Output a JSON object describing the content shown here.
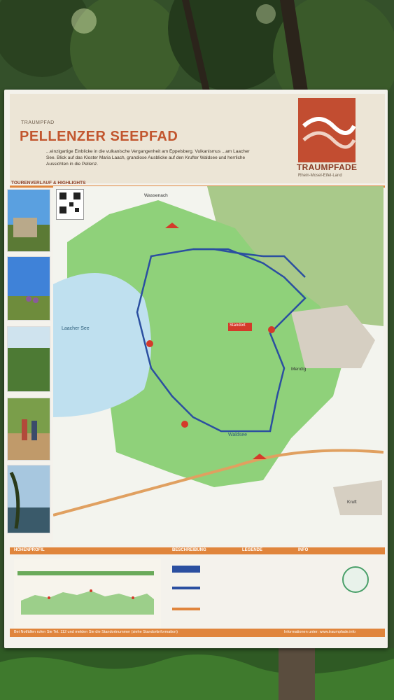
{
  "sign": {
    "kicker": "TRAUMPFAD",
    "title": "PELLENZER SEEPFAD",
    "intro": "...einzigartige Einblicke in die vulkanische Vergangenheit am Eppelsberg. Vulkanismus ...am Laacher See. Blick auf das Kloster Maria Laach, grandiose Ausblicke auf den Krufter Waldsee und herrliche Aussichten in die Pellenz.",
    "logo_name": "TRAUMPFADE",
    "logo_sub": "Rhein-Mosel-Eifel-Land",
    "section_route": "TOURENVERLAUF & HIGHLIGHTS",
    "section_profile": "HÖHENPROFIL",
    "section_description": "BESCHREIBUNG",
    "section_legend": "LEGENDE",
    "section_info": "INFO",
    "footer_left": "Bei Notfällen rufen Sie Tel. 112 und melden Sie die Standortnummer (siehe Standortinformation)",
    "footer_right": "Informationen unter: www.traumpfade.info"
  },
  "map": {
    "lake_label": "Laacher See",
    "town_top": "Wassenach",
    "town_right": "Mendig",
    "town_bottom_right": "Kruft",
    "waldsee": "Waldsee",
    "you_are_here": "Standort"
  },
  "colors": {
    "title": "#c2562e",
    "accent_strip": "#e0853c",
    "route": "#2b4fa0",
    "forest": "#8fd17a",
    "lake": "#bfe0ef"
  }
}
